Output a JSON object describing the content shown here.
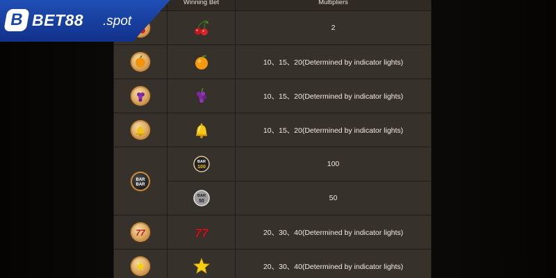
{
  "brand": {
    "logo_letter": "B",
    "name": "BET88",
    "suffix": ".spot",
    "accent": "#1a44a8"
  },
  "table": {
    "headers": [
      "",
      "Winning Bet",
      "Multipliers"
    ],
    "rows": [
      {
        "icon": "cherry-icon",
        "multiplier": "2"
      },
      {
        "icon": "orange-icon",
        "multiplier": "10、15、20(Determined by indicator lights)"
      },
      {
        "icon": "grape-icon",
        "multiplier": "10、15、20(Determined by indicator lights)"
      },
      {
        "icon": "bell-icon",
        "multiplier": "10、15、20(Determined by indicator lights)"
      },
      {
        "icon": "bar-100-icon",
        "multiplier": "100",
        "bar_label": "BAR",
        "bar_number": "100"
      },
      {
        "icon": "bar-50-icon",
        "multiplier": "50",
        "bar_label": "BAR",
        "bar_number": "50"
      },
      {
        "icon": "seven-icon",
        "multiplier": "20、30、40(Determined by indicator lights)"
      },
      {
        "icon": "star-icon",
        "multiplier": "20、30、40(Determined by indicator lights)"
      }
    ],
    "bar_coin_labels": [
      "BAR",
      "BAR"
    ],
    "seven_glyph": "77"
  }
}
